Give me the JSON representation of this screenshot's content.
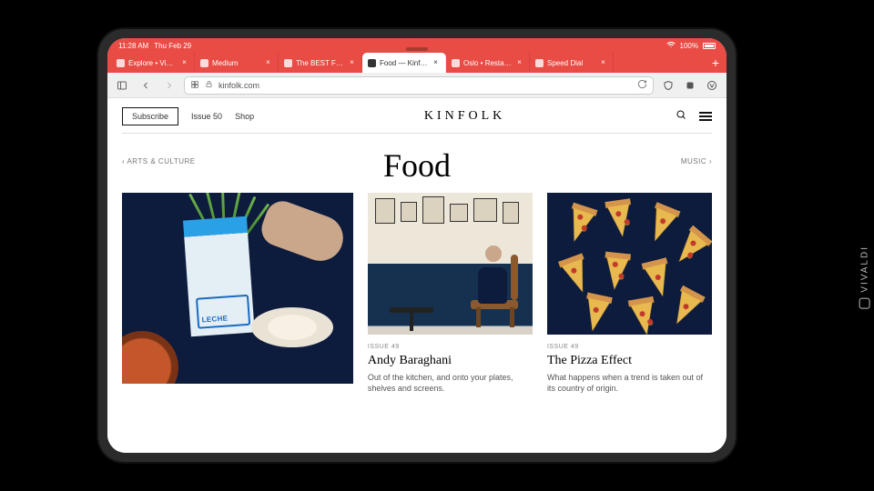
{
  "status": {
    "time": "11:28 AM",
    "date": "Thu Feb 29",
    "battery": "100%"
  },
  "tabs": [
    {
      "label": "Explore • Vivaldi S…"
    },
    {
      "label": "Medium"
    },
    {
      "label": "The BEST Finland…"
    },
    {
      "label": "Food — Kinfolk"
    },
    {
      "label": "Oslo • Restauran…"
    },
    {
      "label": "Speed Dial"
    }
  ],
  "active_tab_index": 3,
  "url": "kinfolk.com",
  "site": {
    "subscribe": "Subscribe",
    "nav1": "Issue 50",
    "nav2": "Shop",
    "brand": "KINFOLK",
    "page_title": "Food",
    "crumb_left": "‹  ARTS & CULTURE",
    "crumb_right": "MUSIC  ›"
  },
  "articles": [
    {
      "issue": "ISSUE 49",
      "title": "Andy Baraghani",
      "text": "Out of the kitchen, and onto your plates, shelves and screens."
    },
    {
      "issue": "ISSUE 49",
      "title": "The Pizza Effect",
      "text": "What happens when a trend is taken out of its country of origin."
    }
  ],
  "milk_label": "LECHE",
  "watermark": "VIVALDI"
}
